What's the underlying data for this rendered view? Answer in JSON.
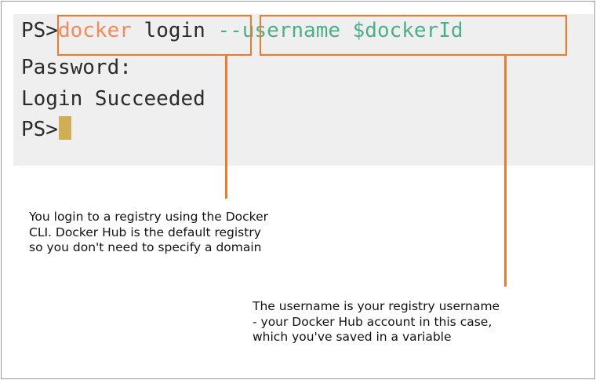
{
  "colors": {
    "accent": "#ef7a2b",
    "command": "#f28a5a",
    "argument": "#4caf8a",
    "text": "#2b2b2b",
    "cursor": "#cfae54",
    "terminal_bg": "#efefef"
  },
  "terminal": {
    "line1": {
      "prompt": "PS>",
      "command": "docker",
      "sub": " login ",
      "flag": "--username ",
      "variable": "$dockerId"
    },
    "line2": "Password:",
    "line3": "Login Succeeded",
    "line4_prompt": "PS>"
  },
  "callouts": {
    "left": "You login to a registry using the Docker\nCLI. Docker Hub is the default registry\nso you don't need to specify a domain",
    "right": "The username is your registry username\n- your Docker Hub account in this case,\nwhich you've saved in a variable"
  }
}
